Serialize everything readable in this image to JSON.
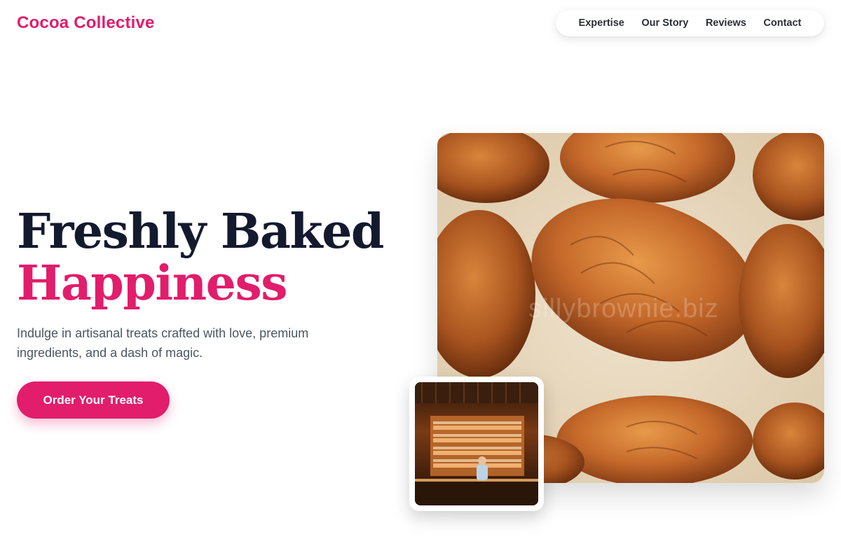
{
  "header": {
    "brand": "Cocoa Collective",
    "nav": [
      {
        "label": "Expertise"
      },
      {
        "label": "Our Story"
      },
      {
        "label": "Reviews"
      },
      {
        "label": "Contact"
      }
    ]
  },
  "hero": {
    "title_line1": "Freshly Baked",
    "title_line2": "Happiness",
    "subtitle": "Indulge in artisanal treats crafted with love, premium ingredients, and a dash of magic.",
    "cta_label": "Order Your Treats"
  },
  "images": {
    "main_alt": "Freshly baked croissants on a baking tray",
    "watermark": "sillybrownie.biz",
    "inset_alt": "Bakery display counter with pastries"
  },
  "colors": {
    "accent": "#e11d6c",
    "heading": "#141a2e",
    "body_text": "#4b5563"
  }
}
